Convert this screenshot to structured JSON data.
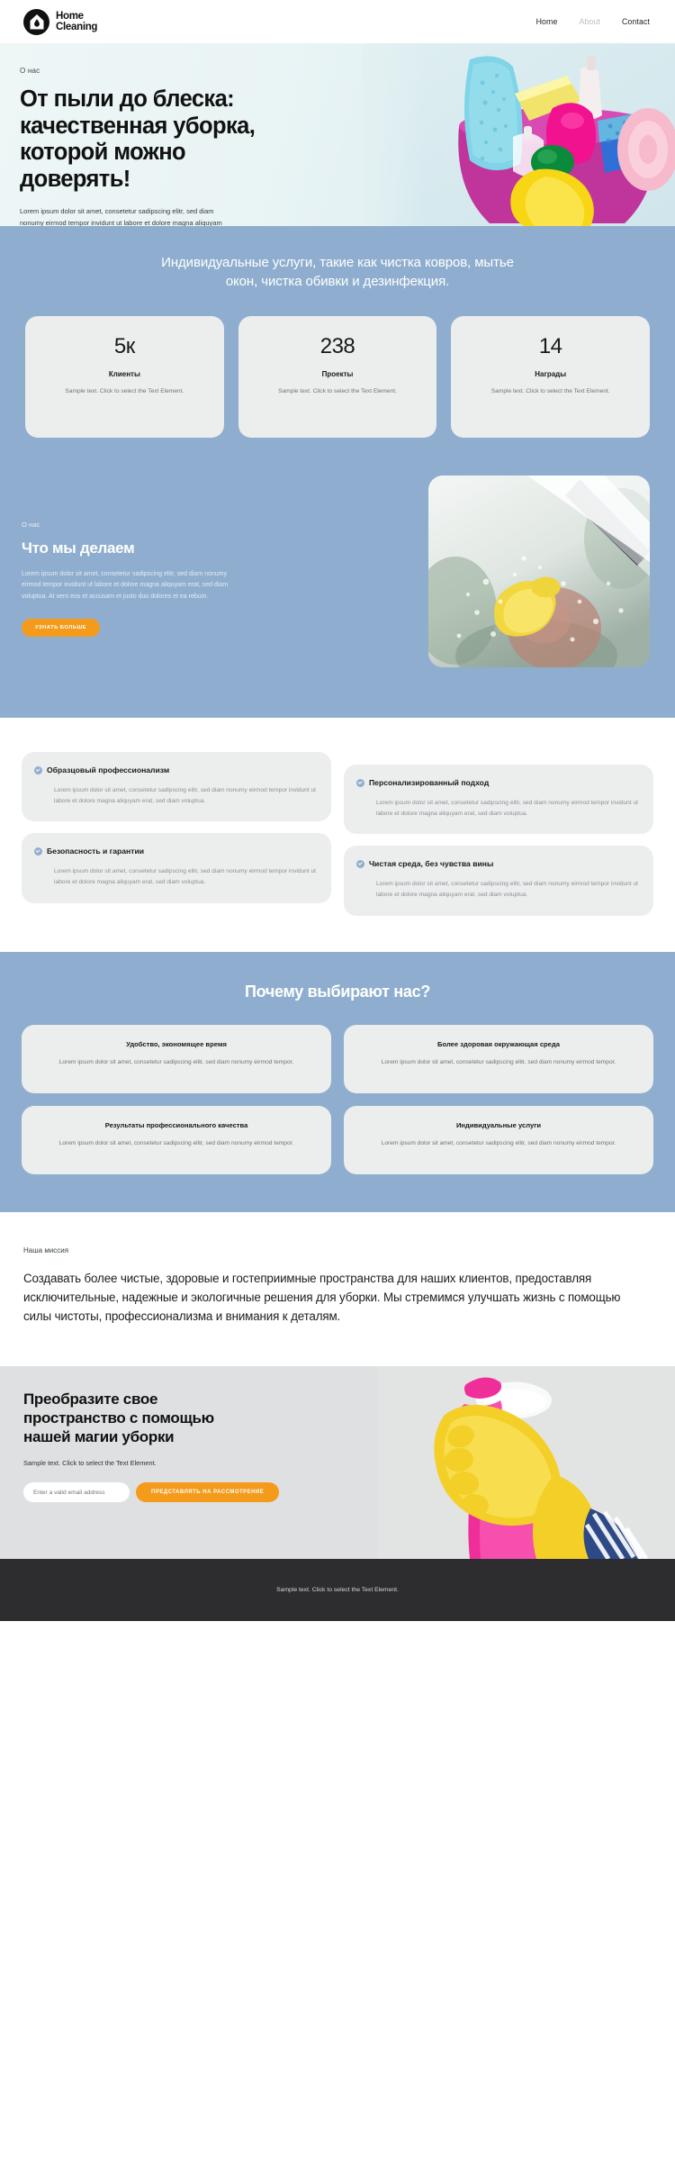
{
  "header": {
    "brand": {
      "line1": "Home",
      "line2": "Cleaning",
      "icon": "house-drop-logo-icon"
    },
    "nav": [
      {
        "label": "Home",
        "muted": false
      },
      {
        "label": "About",
        "muted": true
      },
      {
        "label": "Contact",
        "muted": false
      }
    ]
  },
  "hero": {
    "eyebrow": "О нас",
    "heading": "От пыли до блеска: качественная уборка, которой можно доверять!",
    "paragraph": "Lorem ipsum dolor sit amet, consetetur sadipscing elitr, sed diam nonumy eirmod tempor invidunt ut labore et dolore magna aliquyam erat, sed diam voluptua.",
    "image_alt": "cleaning-supplies-bucket-photo"
  },
  "services": {
    "title": "Индивидуальные услуги, такие как чистка ковров, мытье окон, чистка обивки и дезинфекция.",
    "stats": [
      {
        "number": "5к",
        "label": "Клиенты",
        "sub": "Sample text. Click to select the Text Element."
      },
      {
        "number": "238",
        "label": "Проекты",
        "sub": "Sample text. Click to select the Text Element."
      },
      {
        "number": "14",
        "label": "Награды",
        "sub": "Sample text. Click to select the Text Element."
      }
    ]
  },
  "whatwedo": {
    "eyebrow": "О нас",
    "heading": "Что мы делаем",
    "paragraph": "Lorem ipsum dolor sit amet, consetetur sadipscing elitr, sed diam nonumy eirmod tempor invidunt ut labore et dolore magna aliquyam erat, sed diam voluptua. At vero eos et accusam et justo duo dolores et ea rebum.",
    "button": "УЗНАТЬ БОЛЬШЕ",
    "image_alt": "window-squeegee-cleaning-photo"
  },
  "features": {
    "body": "Lorem ipsum dolor sit amet, consetetur sadipscing elitr, sed diam nonumy eirmod tempor invidunt ut labore et dolore magna aliquyam erat, sed diam voluptua.",
    "left": [
      {
        "title": "Образцовый профессионализм"
      },
      {
        "title": "Безопасность и гарантии"
      }
    ],
    "right": [
      {
        "title": "Персонализированный подход"
      },
      {
        "title": "Чистая среда, без чувства вины"
      }
    ]
  },
  "whyus": {
    "heading": "Почему выбирают нас?",
    "body": "Lorem ipsum dolor sit amet, consetetur sadipscing elitr, sed diam nonumy eirmod tempor.",
    "cards": [
      {
        "title": "Удобство, экономящее время"
      },
      {
        "title": "Более здоровая окружающая среда"
      },
      {
        "title": "Результаты профессионального качества"
      },
      {
        "title": "Индивидуальные услуги"
      }
    ]
  },
  "mission": {
    "eyebrow": "Наша миссия",
    "text": "Создавать более чистые, здоровые и гостеприимные пространства для наших клиентов, предоставляя исключительные, надежные и экологичные решения для уборки. Мы стремимся улучшать жизнь с помощью силы чистоты, профессионализма и внимания к деталям."
  },
  "cta": {
    "heading": "Преобразите свое пространство с помощью нашей магии уборки",
    "sub": "Sample text. Click to select the Text Element.",
    "email_placeholder": "Enter a valid email address",
    "button": "ПРЕДСТАВЛЯТЬ НА РАССМОТРЕНИЕ",
    "image_alt": "pink-spray-bottle-yellow-glove-photo"
  },
  "footer": {
    "text": "Sample text. Click to select the Text Element."
  },
  "colors": {
    "blue": "#8faecf",
    "orange": "#f59b1c",
    "card": "#eceded",
    "footer": "#2d2d2f"
  }
}
